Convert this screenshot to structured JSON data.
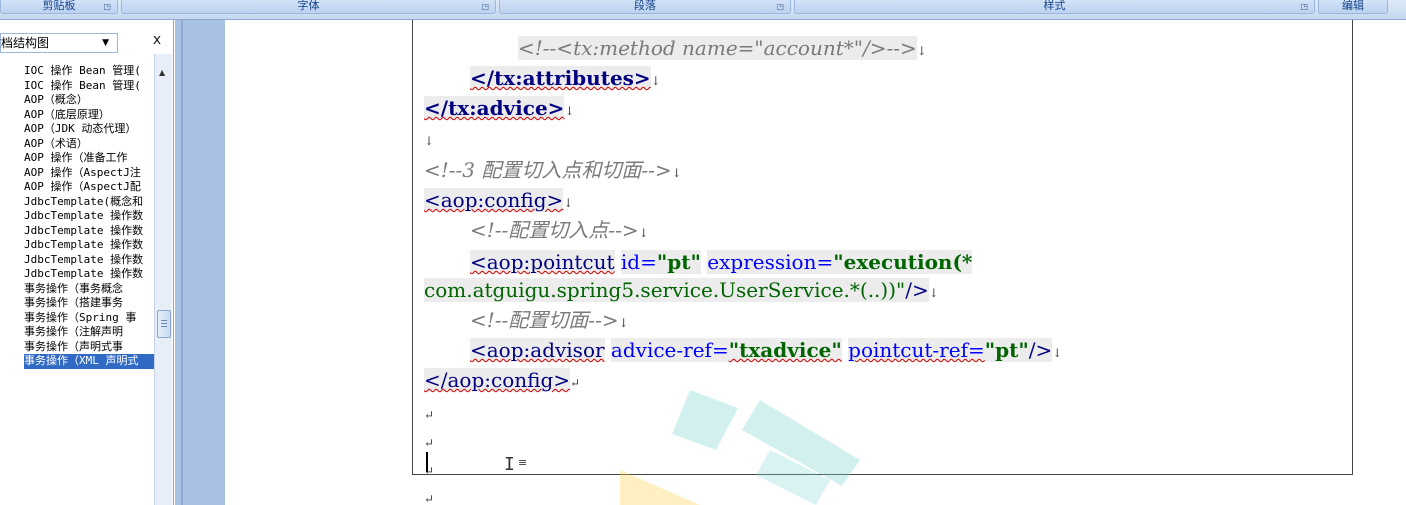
{
  "ribbon": {
    "groups": [
      "剪贴板",
      "字体",
      "段落",
      "样式",
      "编辑"
    ]
  },
  "nav": {
    "dropdown_label": "文档结构图",
    "close_symbol": "x",
    "items": [
      "IOC 操作 Bean 管理(",
      "IOC 操作 Bean 管理(",
      "AOP（概念）",
      "AOP（底层原理）",
      "AOP（JDK 动态代理）",
      "AOP（术语）",
      "AOP 操作（准备工作",
      "AOP 操作（AspectJ注",
      "AOP 操作（AspectJ配",
      "JdbcTemplate(概念和",
      "JdbcTemplate 操作数",
      "JdbcTemplate 操作数",
      "JdbcTemplate 操作数",
      "JdbcTemplate 操作数",
      "JdbcTemplate 操作数",
      "事务操作（事务概念",
      "事务操作（搭建事务",
      "事务操作（Spring 事",
      "事务操作（注解声明",
      "事务操作（声明式事",
      "事务操作（XML 声明式"
    ],
    "selected_index": 20
  },
  "editor": {
    "line_method_comment": "<!--<tx:method name=\"account*\"/>-->",
    "attributes_close": "</tx:attributes>",
    "advice_close": "</tx:advice>",
    "comment_step3": "<!--3 配置切入点和切面-->",
    "aop_config_open": "<aop:config>",
    "comment_pointcut": "<!--配置切入点-->",
    "pointcut_tag": "<aop:pointcut",
    "pointcut_id_attr": "id=",
    "pointcut_id_val": "\"pt\"",
    "pointcut_expr_attr": "expression=",
    "pointcut_expr_val1": "\"execution(*",
    "pointcut_expr_val2": "com.atguigu.spring5.service.UserService.*(..))\"",
    "pointcut_end": "/>",
    "comment_aspect": "<!--配置切面-->",
    "advisor_tag": "<aop:advisor",
    "advisor_ref_attr": "advice-ref=",
    "advisor_ref_val": "\"txadvice\"",
    "advisor_pc_attr": "pointcut-ref=",
    "advisor_pc_val": "\"pt\"",
    "advisor_end": "/>",
    "aop_config_close": "</aop:config>",
    "line_mark": "↓",
    "para_mark": "↵"
  },
  "icons": {
    "dropdown": "triangle-down",
    "close": "close-x",
    "cursor": "i-beam-cursor"
  }
}
